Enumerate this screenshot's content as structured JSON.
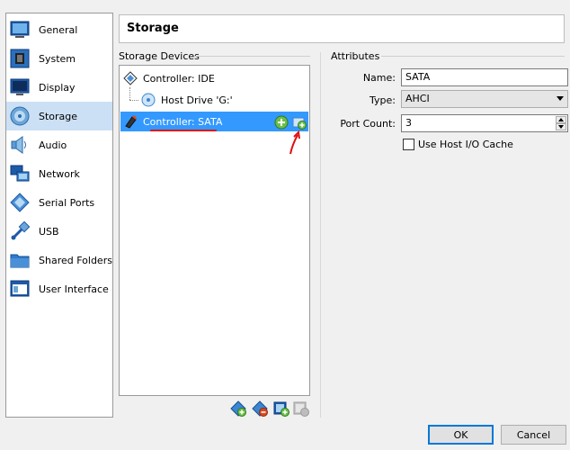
{
  "sidebar": {
    "items": [
      {
        "label": "General",
        "icon": "general-icon"
      },
      {
        "label": "System",
        "icon": "system-chip-icon"
      },
      {
        "label": "Display",
        "icon": "display-monitor-icon"
      },
      {
        "label": "Storage",
        "icon": "storage-disk-icon",
        "selected": true
      },
      {
        "label": "Audio",
        "icon": "audio-speaker-icon"
      },
      {
        "label": "Network",
        "icon": "network-icon"
      },
      {
        "label": "Serial Ports",
        "icon": "serial-ports-icon"
      },
      {
        "label": "USB",
        "icon": "usb-icon"
      },
      {
        "label": "Shared Folders",
        "icon": "shared-folder-icon"
      },
      {
        "label": "User Interface",
        "icon": "user-interface-icon"
      }
    ]
  },
  "page": {
    "title": "Storage"
  },
  "devices": {
    "header": "Storage Devices",
    "tree": [
      {
        "label": "Controller: IDE",
        "icon": "ide-controller-icon"
      },
      {
        "label": "Host Drive 'G:'",
        "icon": "optical-disc-icon"
      },
      {
        "label": "Controller: SATA",
        "icon": "sata-controller-icon",
        "selected": true
      }
    ]
  },
  "attributes": {
    "header": "Attributes",
    "name_label": "Name:",
    "name_value": "SATA",
    "type_label": "Type:",
    "type_value": "AHCI",
    "port_label": "Port Count:",
    "port_value": "3",
    "cache_label": "Use Host I/O Cache",
    "cache_checked": false
  },
  "buttons": {
    "ok": "OK",
    "cancel": "Cancel"
  },
  "colors": {
    "selection": "#3399ff",
    "sidebar_selected": "#cce0f5",
    "annotation": "#e01010"
  }
}
